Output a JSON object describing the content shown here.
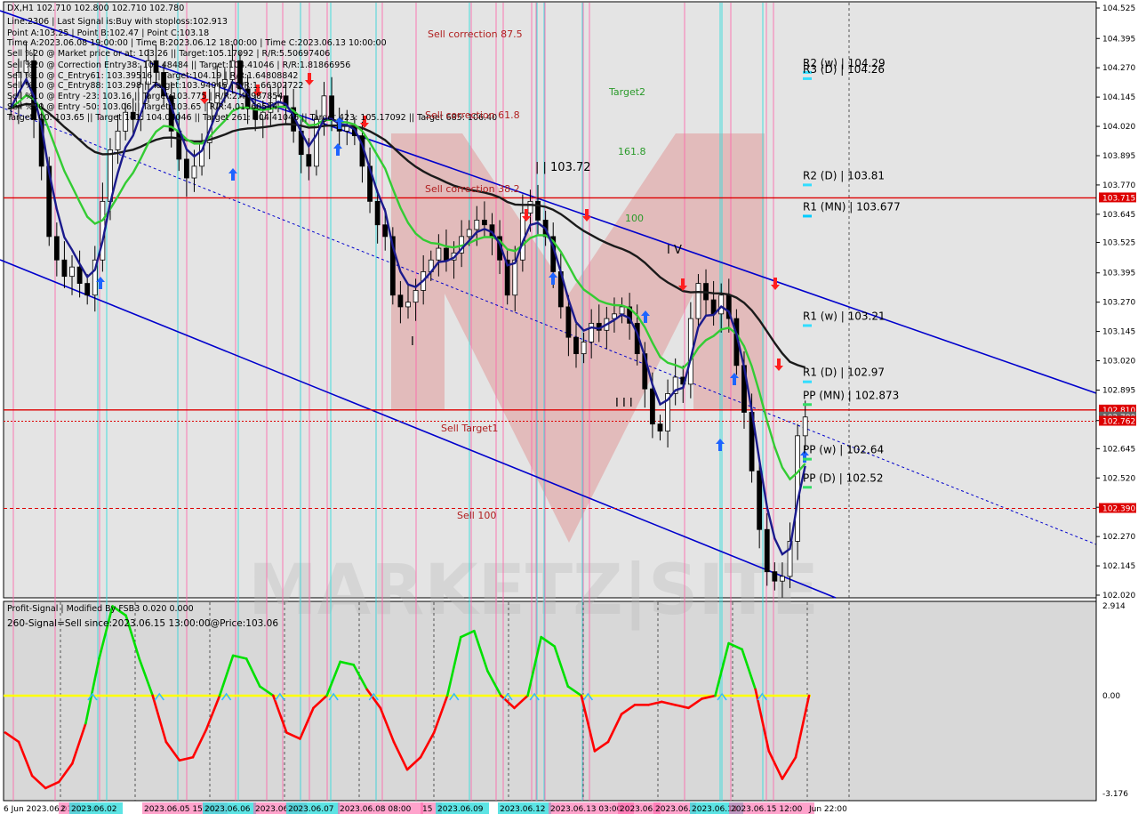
{
  "symbol_header": {
    "line1": "DX,H1  102.710 102.800 102.710 102.780",
    "line2": "Line:2306 | Last Signal is:Buy with stoploss:102.913",
    "line3": "Point A:103.25 | Point B:102.47 | Point C:103.18",
    "line4": "Time A:2023.06.08 19:00:00 | Time B:2023.06.12 18:00:00 | Time C:2023.06.13 10:00:00",
    "line5": "Sell %20 @ Market price or at: 103.26 || Target:105.17092 | R/R:5.50697406",
    "line6": "Sell %20 @ Correction Entry38: 103.48484 || Target:104.41046 | R/R:1.81866956",
    "line7": "Sell %10 @ C_Entry61: 103.39516 || Target:104.19 | R/R:1.64808842",
    "line8": "Sell %10 @ C_Entry88: 103.298 || Target:103.94046 | R/R:1.66302722",
    "line9": "Sell %10 @ Entry -23: 103.16 || Target:103.775 | R/R:2.48987854",
    "line10": "Sell %20 @ Entry -50: 103.06 || Target:103.65 | R/R:4.01360544",
    "line11": "Target100: 103.65 || Target 161: 104.04046 || Target 261: 104.41046 || Target 423: 105.17092 || Target 685: 106.40"
  },
  "indicator_header": {
    "line1": "Profit-Signal | Modified By FSB3 0.020 0.000",
    "line2": "260-Signal=Sell since:2023.06.15 13:00:00@Price:103.06"
  },
  "colors": {
    "background": "#ffffff",
    "panel_bg": "#d8d8d8",
    "channel": "#0000cc",
    "ma_fast": "#1a1a8c",
    "ma_mid": "#33cc33",
    "ma_slow": "#1a1a1a",
    "level_red": "#cc0000",
    "signal_up": "#00e000",
    "signal_down": "#ff0000",
    "zero_line": "#ffff00",
    "pink_vline": "#ff66aa",
    "cyan_vline": "#33dddd",
    "arrow_up": "#1e64ff",
    "arrow_down": "#ff1e1e"
  },
  "annotations": {
    "sell_correction_875": "Sell correction 87.5",
    "sell_correction_618": "Sell correction 61.8",
    "sell_correction_382": "Sell correction 38.2",
    "target2": "Target2",
    "fib_1618": "161.8",
    "fib_100": "100",
    "level_10372": "| | 103.72",
    "wave_iv": "I V",
    "wave_iii": "I I I",
    "wave_i": "I",
    "sell_target1": "Sell Target1",
    "sell_100": "Sell 100",
    "watermark": "MARKETZ|SITE"
  },
  "pivot_labels": [
    {
      "label": "R2 (w) | 104.29",
      "price": 104.29
    },
    {
      "label": "R3 (D) | 104.26",
      "price": 104.26
    },
    {
      "label": "R2 (D) | 103.81",
      "price": 103.81
    },
    {
      "label": "R1 (MN) | 103.677",
      "price": 103.677
    },
    {
      "label": "R1 (w) | 103.21",
      "price": 103.21
    },
    {
      "label": "R1 (D) | 102.97",
      "price": 102.97
    },
    {
      "label": "PP (MN) | 102.873",
      "price": 102.873
    },
    {
      "label": "PP (w) | 102.64",
      "price": 102.64
    },
    {
      "label": "PP (D) | 102.52",
      "price": 102.52
    }
  ],
  "price_scale": [
    "104.525",
    "104.395",
    "104.270",
    "104.145",
    "104.020",
    "103.895",
    "103.770",
    "103.645",
    "103.525",
    "103.395",
    "103.270",
    "103.145",
    "103.020",
    "102.895",
    "102.765",
    "102.645",
    "102.520",
    "102.395",
    "102.270",
    "102.145",
    "102.020"
  ],
  "price_tags": [
    {
      "label": "103.715",
      "price": 103.715,
      "color": "#dd0000"
    },
    {
      "label": "102.810",
      "price": 102.81,
      "color": "#dd0000"
    },
    {
      "label": "102.780",
      "price": 102.78,
      "color": "#666666"
    },
    {
      "label": "102.762",
      "price": 102.762,
      "color": "#dd0000"
    },
    {
      "label": "102.390",
      "price": 102.39,
      "color": "#dd0000"
    }
  ],
  "indicator_scale": [
    {
      "label": "2.914",
      "value": 2.914
    },
    {
      "label": "0.00",
      "value": 0
    },
    {
      "label": "-3.176",
      "value": -3.176
    }
  ],
  "time_labels": [
    "6 Jun 2023.06.01 11:00",
    "2",
    "2023.06.02",
    "2023.06.05 15:00",
    "2023.06.06",
    "2023.06.07",
    "2023.06.07",
    "2023.06.08 08:00",
    "15",
    "2023.06.09",
    "2023.06.12",
    "2023.06.13 03:00",
    "2023.06.",
    "2023.06.",
    "2023.06.14",
    "2023.06.15 12:00",
    "Jun 22:00"
  ],
  "chart_data": {
    "type": "candlestick",
    "title": "DX,H1",
    "ylim": [
      102.02,
      104.55
    ],
    "hlines": [
      {
        "price": 103.715,
        "style": "solid",
        "color": "#dd0000"
      },
      {
        "price": 102.81,
        "style": "solid",
        "color": "#dd0000"
      },
      {
        "price": 102.762,
        "style": "dotted",
        "color": "#dd0000"
      },
      {
        "price": 102.39,
        "style": "dashed",
        "color": "#dd0000"
      }
    ],
    "close_series": [
      104.1,
      104.25,
      104.3,
      104.05,
      103.85,
      103.55,
      103.45,
      103.38,
      103.42,
      103.35,
      103.3,
      103.45,
      103.7,
      103.92,
      104.0,
      104.08,
      104.05,
      104.2,
      104.3,
      104.25,
      104.15,
      104.0,
      103.88,
      103.8,
      103.85,
      103.95,
      104.12,
      104.2,
      104.22,
      104.3,
      104.18,
      104.1,
      104.05,
      104.08,
      104.12,
      104.15,
      104.1,
      104.0,
      103.9,
      103.85,
      104.05,
      104.15,
      104.05,
      104.0,
      104.02,
      103.98,
      103.85,
      103.7,
      103.6,
      103.55,
      103.3,
      103.25,
      103.27,
      103.32,
      103.4,
      103.45,
      103.5,
      103.45,
      103.48,
      103.55,
      103.58,
      103.62,
      103.6,
      103.55,
      103.45,
      103.3,
      103.45,
      103.65,
      103.7,
      103.62,
      103.55,
      103.4,
      103.25,
      103.12,
      103.05,
      103.1,
      103.18,
      103.15,
      103.2,
      103.22,
      103.25,
      103.18,
      103.05,
      102.9,
      102.75,
      102.72,
      102.88,
      102.95,
      102.92,
      103.2,
      103.35,
      103.28,
      103.22,
      103.3,
      103.2,
      103.0,
      102.8,
      102.55,
      102.3,
      102.12,
      102.08,
      102.1,
      102.25,
      102.7,
      102.78
    ]
  },
  "indicator_data": {
    "type": "line",
    "values": [
      -1.2,
      -1.5,
      -2.6,
      -3.0,
      -2.8,
      -2.2,
      -0.9,
      1.2,
      2.9,
      2.6,
      1.2,
      0.0,
      -1.5,
      -2.1,
      -2.0,
      -1.1,
      0.0,
      1.3,
      1.2,
      0.3,
      0.0,
      -1.2,
      -1.4,
      -0.4,
      0.0,
      1.1,
      1.0,
      0.2,
      -0.4,
      -1.5,
      -2.4,
      -2.0,
      -1.2,
      0.0,
      1.9,
      2.1,
      0.8,
      0.0,
      -0.4,
      0.0,
      1.9,
      1.6,
      0.3,
      0.0,
      -1.8,
      -1.5,
      -0.6,
      -0.3,
      -0.3,
      -0.2,
      -0.3,
      -0.4,
      -0.1,
      0.0,
      1.7,
      1.5,
      0.2,
      -1.8,
      -2.7,
      -2.0,
      0.0
    ],
    "threshold": 0
  }
}
